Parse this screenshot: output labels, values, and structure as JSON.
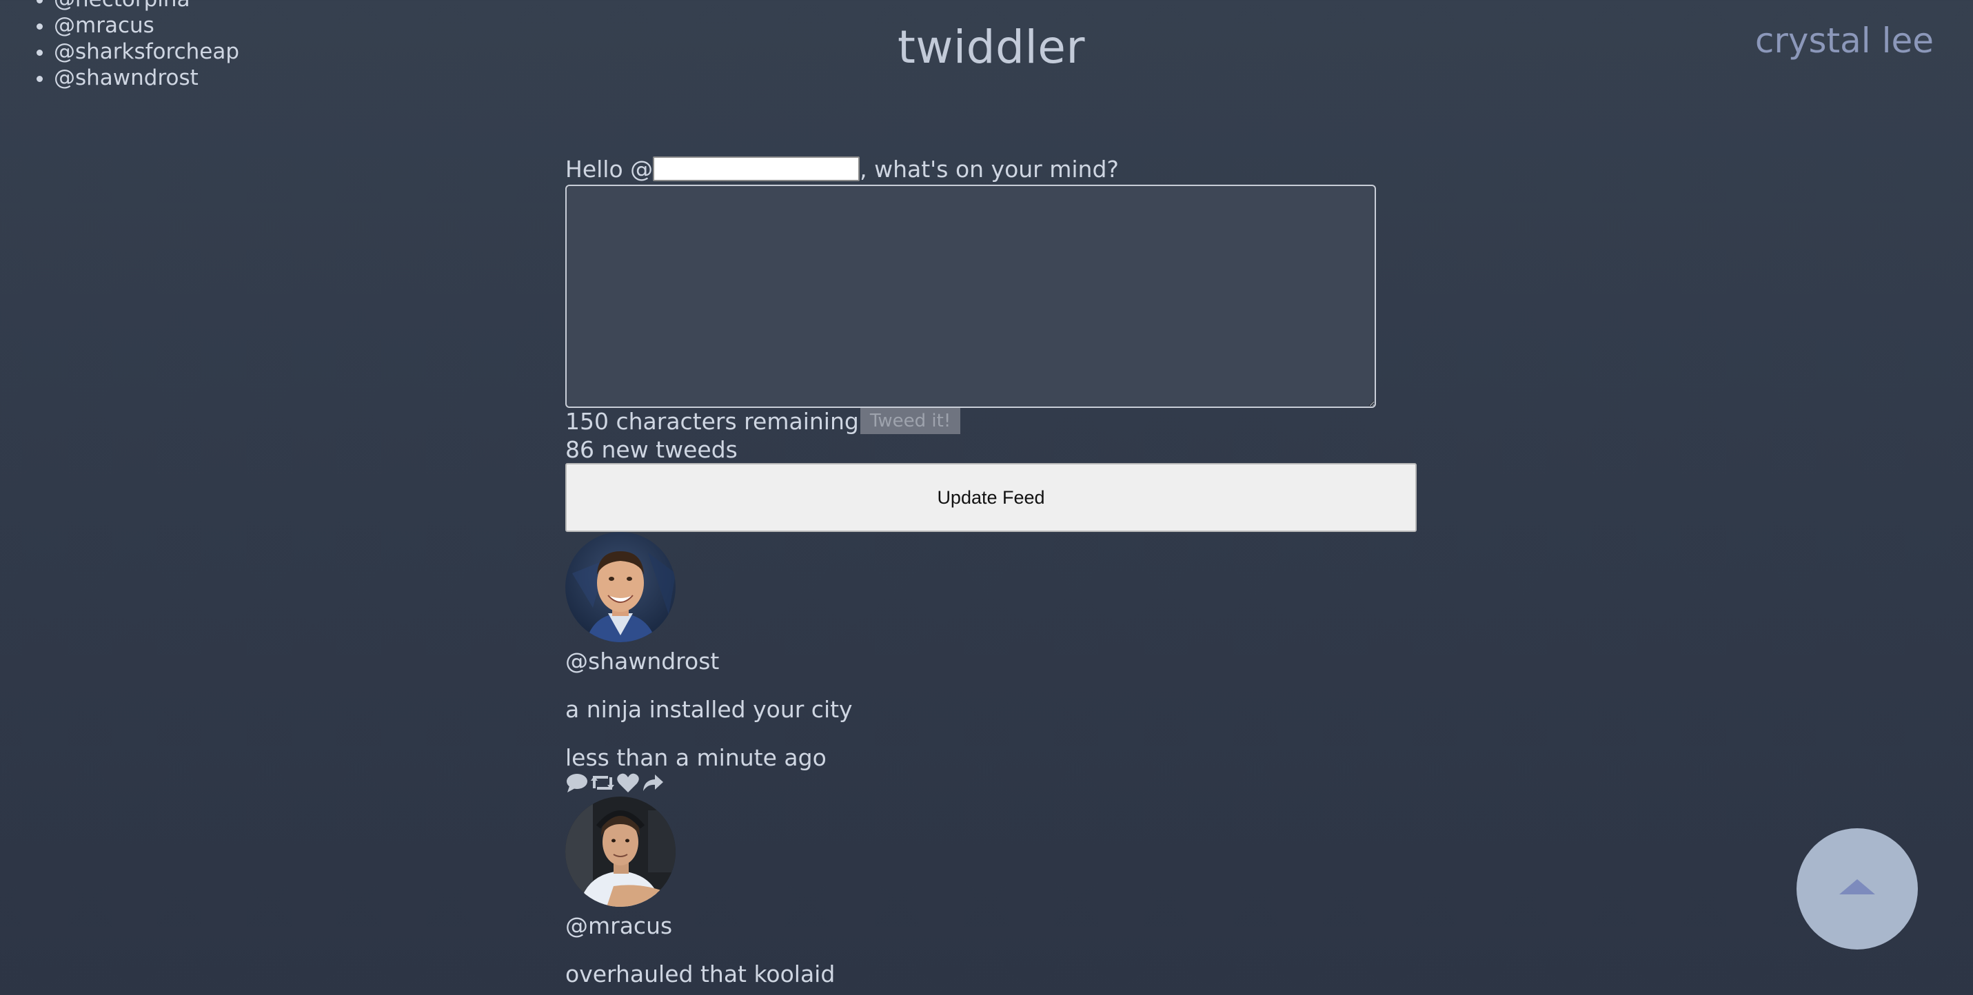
{
  "sidebar": {
    "users": [
      "@hectorpina",
      "@mracus",
      "@sharksforcheap",
      "@shawndrost"
    ]
  },
  "header": {
    "title": "twiddler",
    "current_user": "crystal lee"
  },
  "compose": {
    "greeting_prefix": "Hello @",
    "username_value": "",
    "greeting_suffix": ", what's on your mind?",
    "message_value": "",
    "characters_remaining": "150 characters remaining",
    "submit_label": "Tweed it!"
  },
  "feed": {
    "new_count": "86 new tweeds",
    "update_label": "Update Feed",
    "tweets": [
      {
        "handle": "@shawndrost",
        "text": "a ninja installed your city",
        "time": "less than a minute ago"
      },
      {
        "handle": "@mracus",
        "text": "overhauled that koolaid",
        "time": ""
      }
    ]
  },
  "colors": {
    "background": "#323b4b",
    "text": "#cfd6e2",
    "accent": "#8c98ba",
    "scroll_button": "#a9b7cc"
  },
  "icons": [
    "comment-icon",
    "retweet-icon",
    "heart-icon",
    "share-icon",
    "arrow-up-icon"
  ]
}
